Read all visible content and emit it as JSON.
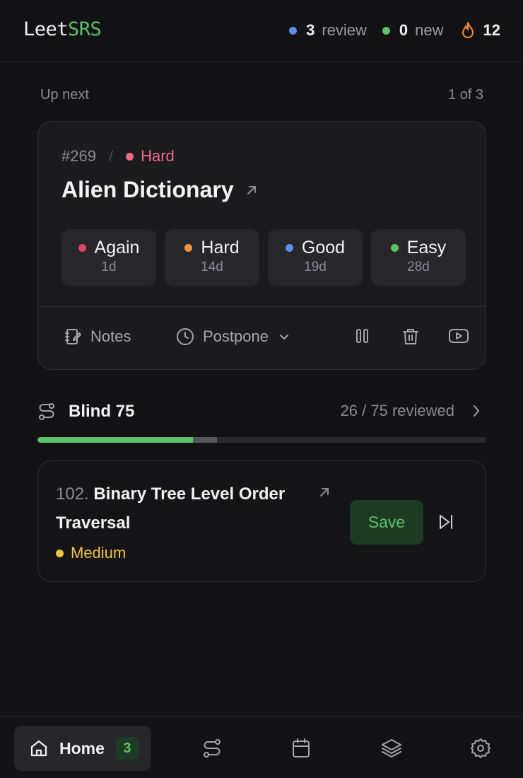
{
  "header": {
    "logo_a": "Leet",
    "logo_b": "SRS",
    "review_count": "3",
    "review_label": "review",
    "new_count": "0",
    "new_label": "new",
    "streak": "12"
  },
  "queue": {
    "label": "Up next",
    "position": "1 of 3"
  },
  "current": {
    "id": "#269",
    "separator": "/",
    "difficulty": "Hard",
    "title": "Alien Dictionary",
    "grades": [
      {
        "label": "Again",
        "interval": "1d",
        "color": "#e2455e"
      },
      {
        "label": "Hard",
        "interval": "14d",
        "color": "#f0903a"
      },
      {
        "label": "Good",
        "interval": "19d",
        "color": "#5b8fe8"
      },
      {
        "label": "Easy",
        "interval": "28d",
        "color": "#5ec26a"
      }
    ],
    "notes_label": "Notes",
    "postpone_label": "Postpone"
  },
  "list": {
    "name": "Blind 75",
    "reviewed_text": "26 / 75 reviewed",
    "progress_reviewed": 0.347,
    "progress_extra": 0.053
  },
  "next_problem": {
    "number": "102.",
    "title": "Binary Tree Level Order Traversal",
    "difficulty": "Medium",
    "save_label": "Save"
  },
  "nav": {
    "home_label": "Home",
    "home_badge": "3"
  },
  "colors": {
    "accent": "#5ec26a",
    "review_dot": "#5b8fe8",
    "new_dot": "#5ec26a",
    "streak": "#f0903a",
    "hard": "#f06b84",
    "medium": "#f2c43f"
  }
}
